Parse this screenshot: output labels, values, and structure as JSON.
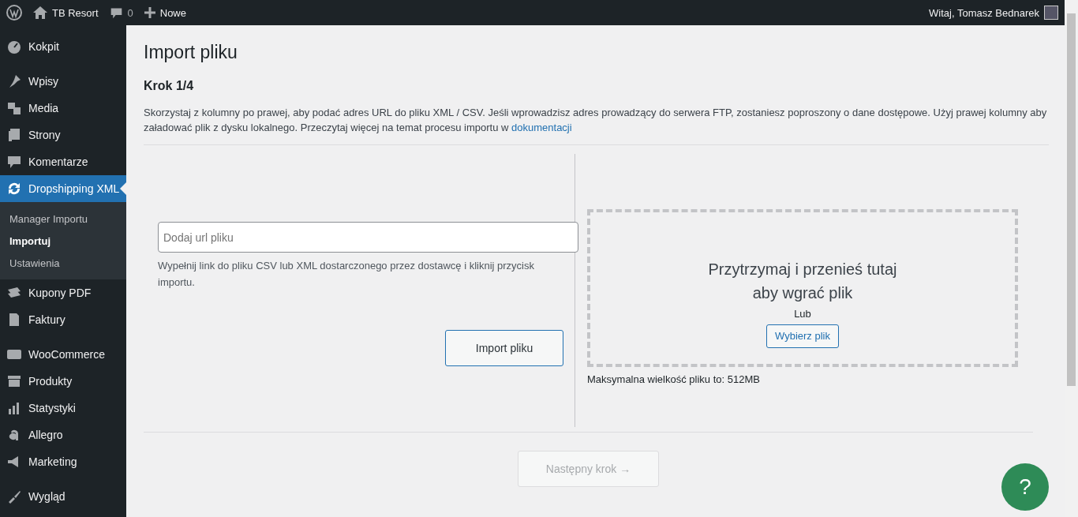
{
  "top_bar": {
    "site": "TB Resort",
    "comments": "0",
    "new": "Nowe",
    "greeting": "Witaj, Tomasz Bednarek"
  },
  "sidebar": {
    "items": [
      {
        "label": "Kokpit",
        "selected": false,
        "gap": false
      },
      {
        "label": "Wpisy",
        "selected": false,
        "gap": true
      },
      {
        "label": "Media",
        "selected": false,
        "gap": false
      },
      {
        "label": "Strony",
        "selected": false,
        "gap": false
      },
      {
        "label": "Komentarze",
        "selected": false,
        "gap": false
      },
      {
        "label": "Dropshipping XML",
        "selected": true,
        "gap": false,
        "children": [
          {
            "label": "Manager Importu",
            "selected": false
          },
          {
            "label": "Importuj",
            "selected": true
          },
          {
            "label": "Ustawienia",
            "selected": false
          }
        ]
      },
      {
        "label": "Kupony PDF",
        "selected": false,
        "gap": false
      },
      {
        "label": "Faktury",
        "selected": false,
        "gap": false
      },
      {
        "label": "WooCommerce",
        "selected": false,
        "gap": true
      },
      {
        "label": "Produkty",
        "selected": false,
        "gap": false
      },
      {
        "label": "Statystyki",
        "selected": false,
        "gap": false
      },
      {
        "label": "Allegro",
        "selected": false,
        "gap": false
      },
      {
        "label": "Marketing",
        "selected": false,
        "gap": false
      },
      {
        "label": "Wygląd",
        "selected": false,
        "gap": true
      }
    ]
  },
  "page": {
    "title": "Import pliku",
    "step": "Krok 1/4",
    "intro": "Skorzystaj z kolumny po prawej, aby podać adres URL do pliku XML / CSV. Jeśli wprowadzisz adres prowadzący do serwera FTP, zostaniesz poproszony o dane dostępowe. Użyj prawej kolumny aby załadować plik z dysku lokalnego. Przeczytaj więcej na temat procesu importu w ",
    "intro_link": "dokumentacji",
    "url_field": {
      "placeholder": "Dodaj url pliku"
    },
    "url_hint": "Wypełnij link do pliku CSV lub XML dostarczonego przez dostawcę i kliknij przycisk importu.",
    "import_button": "Import pliku",
    "drop_text": [
      "Przytrzymaj i przenieś tutaj",
      "aby wgrać plik"
    ],
    "or": "Lub",
    "choose_button": "Wybierz plik",
    "max_size": "Maksymalna wielkość pliku to: 512MB",
    "next_button": {
      "label": "Następny krok →",
      "disabled": true
    },
    "help_button": "?"
  }
}
